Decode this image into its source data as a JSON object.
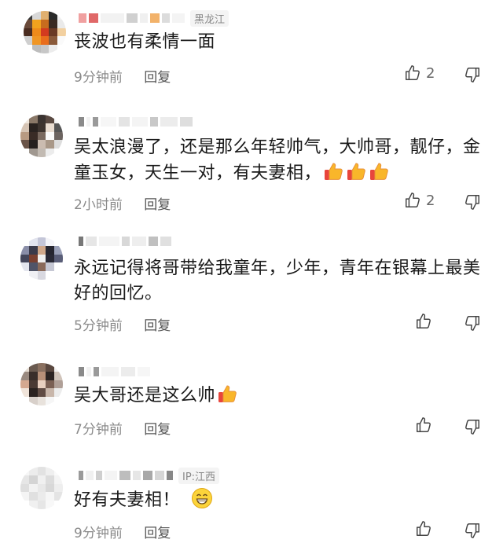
{
  "comments": [
    {
      "location": "黑龙江",
      "text": "丧波也有柔情一面",
      "time": "9分钟前",
      "reply_label": "回复",
      "likes": "2"
    },
    {
      "location": "",
      "text": "吴太浪漫了，还是那么年轻帅气，大帅哥，靓仔，金童玉女，天生一对，有夫妻相，",
      "time": "2小时前",
      "reply_label": "回复",
      "likes": "2"
    },
    {
      "location": "",
      "text": "永远记得将哥带给我童年，少年，青年在银幕上最美好的回忆。",
      "time": "5分钟前",
      "reply_label": "回复",
      "likes": ""
    },
    {
      "location": "",
      "text": "吴大哥还是这么帅",
      "time": "7分钟前",
      "reply_label": "回复",
      "likes": ""
    },
    {
      "location": "IP:江西",
      "text": "好有夫妻相！",
      "time": "9分钟前",
      "reply_label": "回复",
      "likes": ""
    }
  ],
  "icons": {
    "like": "thumbs-up-outline-icon",
    "dislike": "thumbs-down-outline-icon",
    "emoji_thumb": "thumbs-up-emoji",
    "emoji_grin": "grinning-emoji"
  }
}
